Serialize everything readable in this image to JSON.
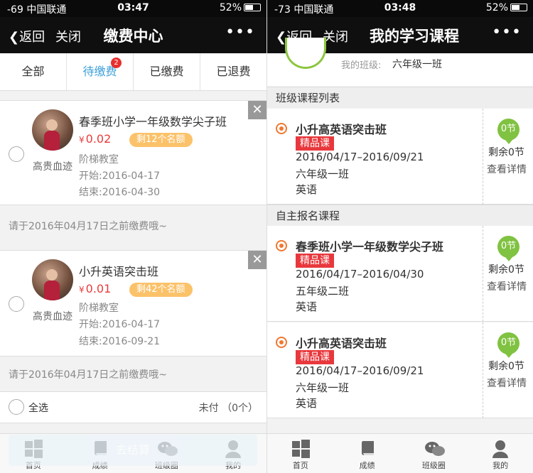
{
  "left": {
    "status": {
      "signal": "-69 中国联通",
      "time": "03:47",
      "battery": "52%"
    },
    "nav": {
      "back": "返回",
      "close": "关闭",
      "title": "缴费中心",
      "more": "•••"
    },
    "tabs": [
      {
        "label": "全部"
      },
      {
        "label": "待缴费",
        "badge": "2"
      },
      {
        "label": "已缴费"
      },
      {
        "label": "已退费"
      }
    ],
    "orders": [
      {
        "user": "高贵血迹",
        "title": "春季班小学一年级数学尖子班",
        "currency": "¥",
        "price": "0.02",
        "quota": "剩12个名额",
        "school": "阶梯教室",
        "start": "开始:2016-04-17",
        "end": "结束:2016-04-30",
        "note": "请于2016年04月17日之前缴费哦~"
      },
      {
        "user": "高贵血迹",
        "title": "小升英语突击班",
        "currency": "¥",
        "price": "0.01",
        "quota": "剩42个名额",
        "school": "阶梯教室",
        "start": "开始:2016-04-17",
        "end": "结束:2016-09-21",
        "note": "请于2016年04月17日之前缴费哦~"
      }
    ],
    "select_all": "全选",
    "unpaid": "未付 （0个）",
    "checkout": "去结算",
    "tabbar": [
      {
        "label": "首页",
        "icon": "windows-icon"
      },
      {
        "label": "成绩",
        "icon": "book-icon"
      },
      {
        "label": "班级圈",
        "icon": "chat-icon"
      },
      {
        "label": "我的",
        "icon": "user-icon"
      }
    ]
  },
  "right": {
    "status": {
      "signal": "-73 中国联通",
      "time": "03:48",
      "battery": "52%"
    },
    "nav": {
      "back": "返回",
      "close": "关闭",
      "title": "我的学习课程",
      "more": "•••"
    },
    "class_label": "我的班级:",
    "class_value": "六年级一班",
    "sections": [
      {
        "title": "班级课程列表",
        "courses": [
          {
            "title": "小升高英语突击班",
            "tag": "精品课",
            "dates": "2016/04/17–2016/09/21",
            "class": "六年级一班",
            "subject": "英语",
            "count": "0节",
            "remain": "剩余0节",
            "detail": "查看详情"
          }
        ]
      },
      {
        "title": "自主报名课程",
        "courses": [
          {
            "title": "春季班小学一年级数学尖子班",
            "tag": "精品课",
            "dates": "2016/04/17–2016/04/30",
            "class": "五年级二班",
            "subject": "英语",
            "count": "0节",
            "remain": "剩余0节",
            "detail": "查看详情"
          },
          {
            "title": "小升高英语突击班",
            "tag": "精品课",
            "dates": "2016/04/17–2016/09/21",
            "class": "六年级一班",
            "subject": "英语",
            "count": "0节",
            "remain": "剩余0节",
            "detail": "查看详情"
          }
        ]
      }
    ],
    "tabbar": [
      {
        "label": "首页",
        "icon": "windows-icon"
      },
      {
        "label": "成绩",
        "icon": "book-icon"
      },
      {
        "label": "班级圈",
        "icon": "chat-icon"
      },
      {
        "label": "我的",
        "icon": "user-icon"
      }
    ]
  }
}
